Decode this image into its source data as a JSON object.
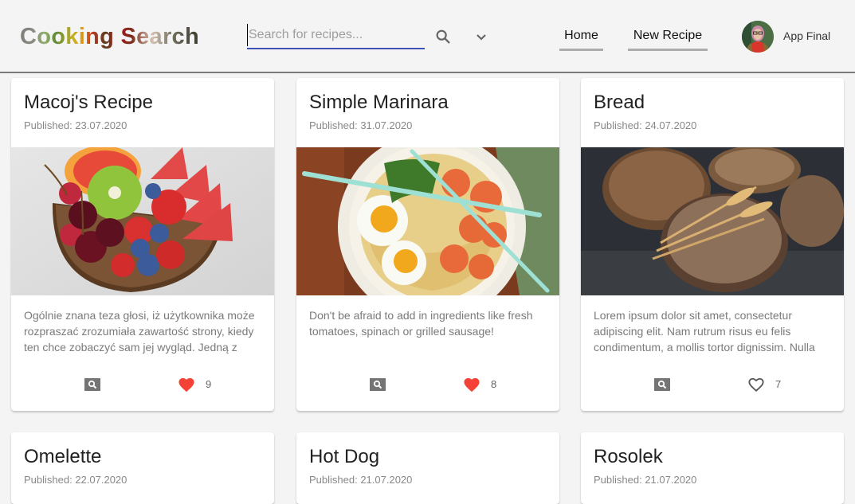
{
  "header": {
    "logo": "Cooking Search",
    "search": {
      "placeholder": "Search for recipes...",
      "value": ""
    },
    "search_icon": "search-icon",
    "expand_icon": "chevron-down-icon",
    "nav": [
      {
        "label": "Home"
      },
      {
        "label": "New Recipe"
      }
    ],
    "user": {
      "name": "App Final"
    }
  },
  "colors": {
    "accent": "#3f51b5",
    "like_active": "#f44336",
    "like_inactive": "#555555",
    "view_icon_bg": "#757575"
  },
  "recipes": [
    {
      "title": "Macoj's Recipe",
      "published": "Published: 23.07.2020",
      "image": "fruit-bowl",
      "description": "Ogólnie znana teza głosi, iż użytkownika może rozpraszać zrozumiała zawartość strony, kiedy ten chce zobaczyć sam jej wygląd. Jedną z mocnych stron używania Lorem Ipsum jest to, że ma wiele różnych",
      "likes": "9",
      "liked": true
    },
    {
      "title": "Simple Marinara",
      "published": "Published: 31.07.2020",
      "image": "ramen-bowl",
      "description": "Don't be afraid to add in ingredients like fresh tomatoes, spinach or grilled sausage!",
      "likes": "8",
      "liked": true
    },
    {
      "title": "Bread",
      "published": "Published: 24.07.2020",
      "image": "bread-loaves",
      "description": "Lorem ipsum dolor sit amet, consectetur adipiscing elit. Nam rutrum risus eu felis condimentum, a mollis tortor dignissim. Nulla facilisi. Sed nec tincidunt velit.",
      "likes": "7",
      "liked": false
    },
    {
      "title": "Omelette",
      "published": "Published: 22.07.2020"
    },
    {
      "title": "Hot Dog",
      "published": "Published: 21.07.2020"
    },
    {
      "title": "Rosolek",
      "published": "Published: 21.07.2020"
    }
  ]
}
